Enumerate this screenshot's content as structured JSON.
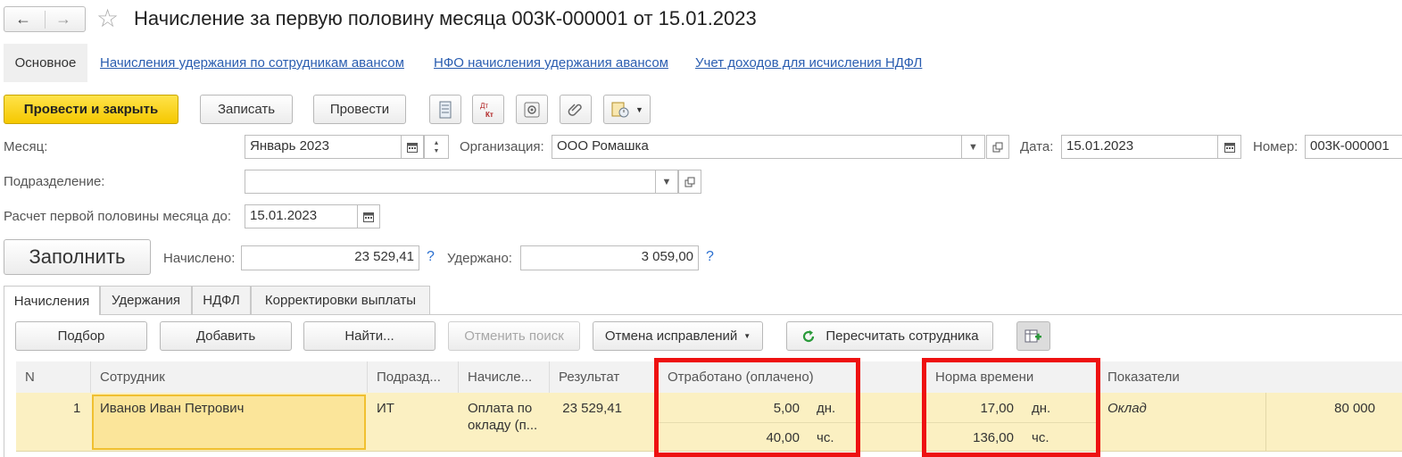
{
  "window": {
    "title": "Начисление за первую половину месяца 003К-000001 от 15.01.2023",
    "back": "←",
    "forward": "→",
    "star": "☆"
  },
  "nav": {
    "main": "Основное",
    "links": [
      "Начисления удержания по сотрудникам авансом",
      "НФО начисления удержания авансом",
      "Учет доходов для исчисления НДФЛ"
    ]
  },
  "toolbar": {
    "post_close": "Провести и закрыть",
    "save": "Записать",
    "post": "Провести"
  },
  "form": {
    "month_label": "Месяц:",
    "month_value": "Январь 2023",
    "org_label": "Организация:",
    "org_value": "ООО Ромашка",
    "date_label": "Дата:",
    "date_value": "15.01.2023",
    "number_label": "Номер:",
    "number_value": "003К-000001",
    "division_label": "Подразделение:",
    "division_value": "",
    "calc_label": "Расчет первой половины месяца до:",
    "calc_value": "15.01.2023",
    "fill": "Заполнить",
    "accrued_label": "Начислено:",
    "accrued_value": "23 529,41",
    "withheld_label": "Удержано:",
    "withheld_value": "3 059,00",
    "help": "?"
  },
  "tabs": [
    "Начисления",
    "Удержания",
    "НДФЛ",
    "Корректировки выплаты"
  ],
  "table_toolbar": {
    "pick": "Подбор",
    "add": "Добавить",
    "find": "Найти...",
    "cancel_search": "Отменить поиск",
    "cancel_fix": "Отмена исправлений",
    "recalc": "Пересчитать сотрудника"
  },
  "table": {
    "headers": [
      "N",
      "Сотрудник",
      "Подразд...",
      "Начисле...",
      "Результат",
      "Отработано (оплачено)",
      "Норма времени",
      "Показатели"
    ],
    "row": {
      "n": "1",
      "employee": "Иванов Иван Петрович",
      "division": "ИТ",
      "accrual_line1": "Оплата по",
      "accrual_line2": "окладу (п...",
      "result": "23 529,41",
      "worked_days": "5,00",
      "worked_hours": "40,00",
      "norm_days": "17,00",
      "norm_hours": "136,00",
      "unit_days": "дн.",
      "unit_hours": "чс.",
      "indicator": "Оклад",
      "indicator_value": "80 000"
    }
  },
  "colors": {
    "primary": "#f5c800",
    "highlight": "#ee1111",
    "row_bg": "#fbf0c2",
    "link": "#2a5db0"
  }
}
